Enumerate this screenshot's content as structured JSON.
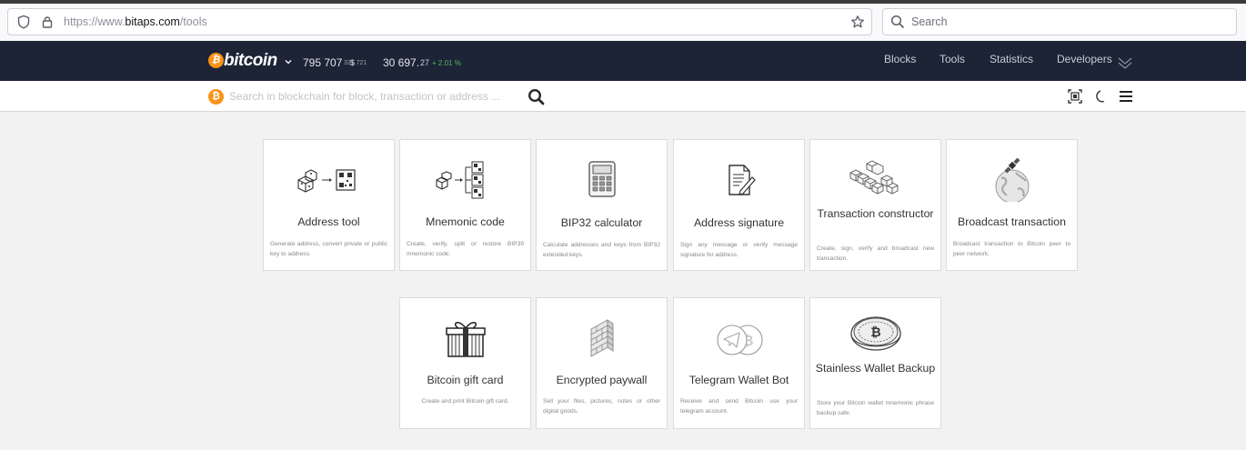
{
  "browser": {
    "url_prefix": "https://www.",
    "url_domain": "bitaps.com",
    "url_path": "/tools",
    "search_placeholder": "Search"
  },
  "navbar": {
    "brand": "bitcoin",
    "block_height": "795 707",
    "block_sub": "331 721",
    "price_currency": "$",
    "price": "30 697.",
    "price_decimals": "27",
    "price_change": "+ 2.01 %",
    "links": [
      "Blocks",
      "Tools",
      "Statistics",
      "Developers"
    ]
  },
  "site_search": {
    "placeholder": "Search in blockchain for block, transaction or address ..."
  },
  "tools": [
    {
      "title": "Address tool",
      "desc": "Generate address, convert private or public key to address.",
      "icon": "dice-qr-icon"
    },
    {
      "title": "Mnemonic code",
      "desc": "Create, verify, split or restore BIP39 mnemonic code.",
      "icon": "dice-qr-split-icon"
    },
    {
      "title": "BIP32 calculator",
      "desc": "Calculate addresses and keys from BIP32 extended keys.",
      "icon": "calculator-icon"
    },
    {
      "title": "Address signature",
      "desc": "Sign any message or verify message signature for address.",
      "icon": "document-sign-icon"
    },
    {
      "title": "Transaction constructor",
      "desc": "Create, sign, verify and broadcast new transaction.",
      "icon": "cubes-icon"
    },
    {
      "title": "Broadcast transaction",
      "desc": "Broadcast transaction to Bitcoin peer to peer network.",
      "icon": "satellite-globe-icon"
    },
    {
      "title": "Bitcoin gift card",
      "desc": "Create and print Bitcoin gift card.",
      "icon": "gift-icon"
    },
    {
      "title": "Encrypted paywall",
      "desc": "Sell your files, pictures, notes or other digital goods.",
      "icon": "brick-wall-icon"
    },
    {
      "title": "Telegram Wallet Bot",
      "desc": "Receive and send Bitcoin use your telegram account.",
      "icon": "telegram-bitcoin-icon"
    },
    {
      "title": "Stainless Wallet Backup",
      "desc": "Store your Bitcoin wallet mnemonic phrase backup safe.",
      "icon": "steel-backup-icon"
    }
  ]
}
